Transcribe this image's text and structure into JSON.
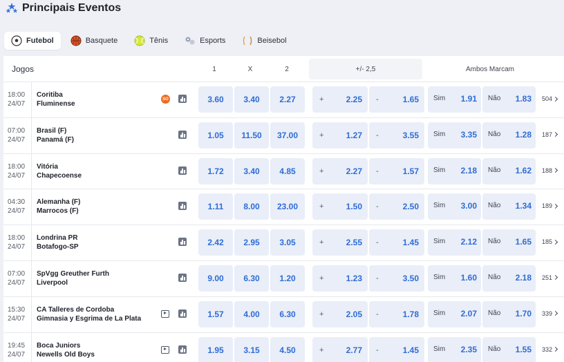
{
  "header": {
    "title": "Principais Eventos"
  },
  "tabs": [
    {
      "label": "Futebol",
      "icon": "soccer-ball-icon",
      "active": true
    },
    {
      "label": "Basquete",
      "icon": "basketball-icon",
      "active": false
    },
    {
      "label": "Tênis",
      "icon": "tennis-ball-icon",
      "active": false
    },
    {
      "label": "Esports",
      "icon": "esports-icon",
      "active": false
    },
    {
      "label": "Beisebol",
      "icon": "baseball-icon",
      "active": false
    }
  ],
  "table": {
    "headers": {
      "jogos": "Jogos",
      "one": "1",
      "x": "X",
      "two": "2",
      "over_under": "+/- 2,5",
      "both_score": "Ambos Marcam"
    },
    "labels": {
      "plus": "+",
      "minus": "-",
      "sim": "Sim",
      "nao": "Não"
    },
    "rows": [
      {
        "time": "18:00",
        "date": "24/07",
        "home": "Coritiba",
        "away": "Fluminense",
        "badge": "SO",
        "tv": false,
        "odds": [
          "3.60",
          "3.40",
          "2.27"
        ],
        "over": "2.25",
        "under": "1.65",
        "sim": "1.91",
        "nao": "1.83",
        "more": "504"
      },
      {
        "time": "07:00",
        "date": "24/07",
        "home": "Brasil (F)",
        "away": "Panamá (F)",
        "badge": "",
        "tv": false,
        "odds": [
          "1.05",
          "11.50",
          "37.00"
        ],
        "over": "1.27",
        "under": "3.55",
        "sim": "3.35",
        "nao": "1.28",
        "more": "187"
      },
      {
        "time": "18:00",
        "date": "24/07",
        "home": "Vitória",
        "away": "Chapecoense",
        "badge": "",
        "tv": false,
        "odds": [
          "1.72",
          "3.40",
          "4.85"
        ],
        "over": "2.27",
        "under": "1.57",
        "sim": "2.18",
        "nao": "1.62",
        "more": "188"
      },
      {
        "time": "04:30",
        "date": "24/07",
        "home": "Alemanha (F)",
        "away": "Marrocos (F)",
        "badge": "",
        "tv": false,
        "odds": [
          "1.11",
          "8.00",
          "23.00"
        ],
        "over": "1.50",
        "under": "2.50",
        "sim": "3.00",
        "nao": "1.34",
        "more": "189"
      },
      {
        "time": "18:00",
        "date": "24/07",
        "home": "Londrina PR",
        "away": "Botafogo-SP",
        "badge": "",
        "tv": false,
        "odds": [
          "2.42",
          "2.95",
          "3.05"
        ],
        "over": "2.55",
        "under": "1.45",
        "sim": "2.12",
        "nao": "1.65",
        "more": "185"
      },
      {
        "time": "07:00",
        "date": "24/07",
        "home": "SpVgg Greuther Furth",
        "away": "Liverpool",
        "badge": "",
        "tv": false,
        "odds": [
          "9.00",
          "6.30",
          "1.20"
        ],
        "over": "1.23",
        "under": "3.50",
        "sim": "1.60",
        "nao": "2.18",
        "more": "251"
      },
      {
        "time": "15:30",
        "date": "24/07",
        "home": "CA Talleres de Cordoba",
        "away": "Gimnasia y Esgrima de La Plata",
        "badge": "",
        "tv": true,
        "odds": [
          "1.57",
          "4.00",
          "6.30"
        ],
        "over": "2.05",
        "under": "1.78",
        "sim": "2.07",
        "nao": "1.70",
        "more": "339"
      },
      {
        "time": "19:45",
        "date": "24/07",
        "home": "Boca Juniors",
        "away": "Newells Old Boys",
        "badge": "",
        "tv": true,
        "odds": [
          "1.95",
          "3.15",
          "4.50"
        ],
        "over": "2.77",
        "under": "1.45",
        "sim": "2.35",
        "nao": "1.55",
        "more": "332"
      }
    ]
  }
}
